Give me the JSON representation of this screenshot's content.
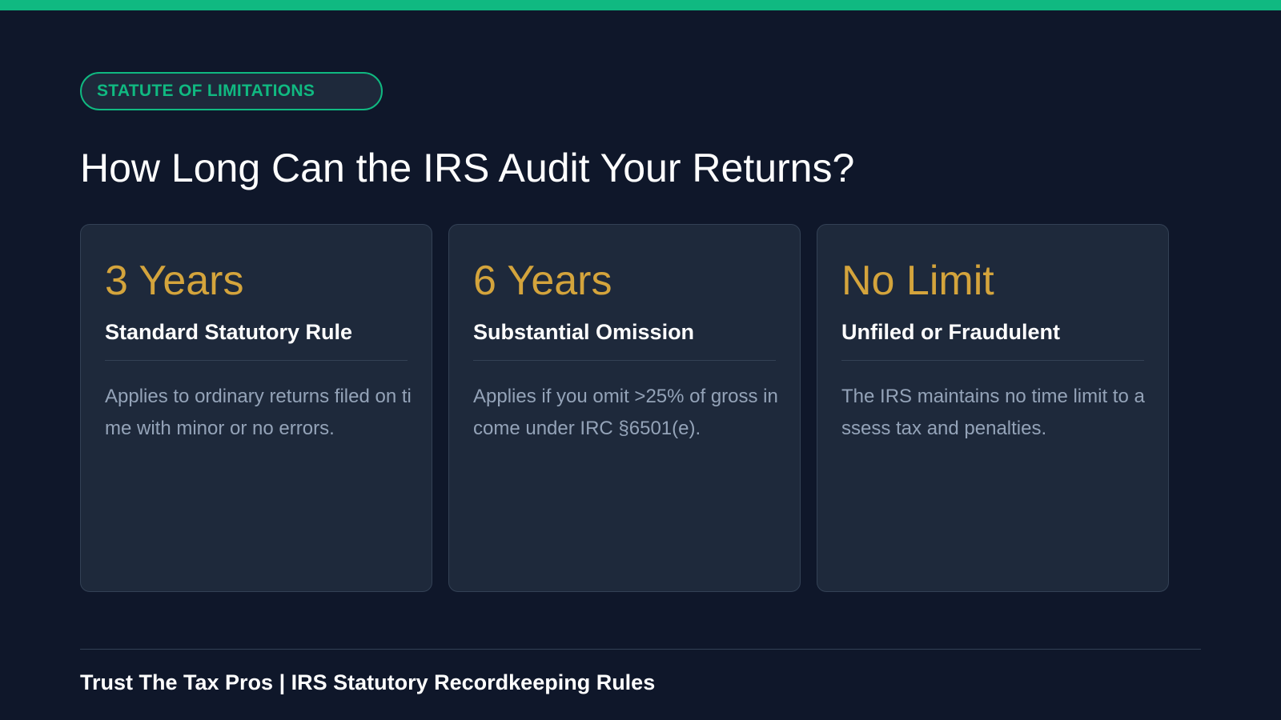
{
  "colors": {
    "background": "#0f172a",
    "accent": "#10b981",
    "card_background": "#1e293b",
    "card_value": "#d4a43c",
    "description_text": "#94a3b8"
  },
  "badge": {
    "label": "STATUTE OF LIMITATIONS"
  },
  "title": "How Long Can the IRS Audit Your Returns?",
  "cards": [
    {
      "value": "3 Years",
      "heading": "Standard Statutory Rule",
      "description": "Applies to ordinary returns filed on time with minor or no errors."
    },
    {
      "value": "6 Years",
      "heading": "Substantial Omission",
      "description": "Applies if you omit >25% of gross income under IRC §6501(e)."
    },
    {
      "value": "No Limit",
      "heading": "Unfiled or Fraudulent",
      "description": "The IRS maintains no time limit to assess tax and penalties."
    }
  ],
  "footer": {
    "text": "Trust The Tax Pros | IRS Statutory Recordkeeping Rules"
  }
}
